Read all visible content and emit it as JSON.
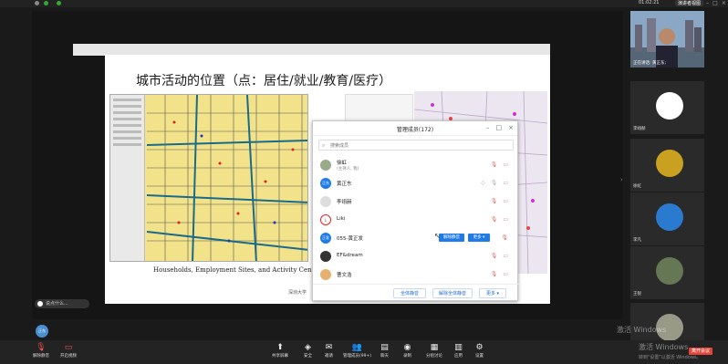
{
  "titlebar": {
    "timer": "01:02:21",
    "view_btn": "演讲者视图"
  },
  "slide": {
    "title": "城市活动的位置（点：居住/就业/教育/医疗）",
    "caption": "Households, Employment Sites, and Activity Centers",
    "university": "深圳大学"
  },
  "dialog": {
    "title": "管理成员(172)",
    "search_placeholder": "搜索成员",
    "members": [
      {
        "name": "徐虹",
        "sub": "(主持人, 我)",
        "avatar": "photo"
      },
      {
        "name": "黄正东",
        "sub": "",
        "avatar": "正东"
      },
      {
        "name": "李翊赫",
        "sub": "",
        "avatar": "photo"
      },
      {
        "name": "Liki",
        "sub": "",
        "avatar": "photo"
      },
      {
        "name": "055-黄正发",
        "sub": "",
        "avatar": "正发",
        "buttons": [
          "解除静音",
          "更多 ▾"
        ]
      },
      {
        "name": "EF&dream",
        "sub": "",
        "avatar": "photo"
      },
      {
        "name": "曹文浩",
        "sub": "",
        "avatar": "photo"
      }
    ],
    "footer": {
      "mute_all": "全体静音",
      "unmute_all": "解除全体静音",
      "more": "更多 ▾"
    }
  },
  "sidebar": {
    "speaker_label": "正在讲话: 黄正东;",
    "tiles": [
      {
        "name": "李翊赫"
      },
      {
        "name": "徐虹"
      },
      {
        "name": "李凡"
      },
      {
        "name": "王锐"
      }
    ]
  },
  "chat": {
    "text": "说点什么..."
  },
  "self_avatar": "正东",
  "toolbar": {
    "items": [
      {
        "label": "解除静音",
        "icon": "mic-muted-icon"
      },
      {
        "label": "开启视频",
        "icon": "video-off-icon"
      },
      {
        "label": "共享屏幕",
        "icon": "share-screen-icon"
      },
      {
        "label": "安全",
        "icon": "shield-icon"
      },
      {
        "label": "邀请",
        "icon": "invite-icon"
      },
      {
        "label": "管理成员(99+)",
        "icon": "members-icon"
      },
      {
        "label": "聊天",
        "icon": "chat-icon"
      },
      {
        "label": "录制",
        "icon": "record-icon"
      },
      {
        "label": "分组讨论",
        "icon": "breakout-icon"
      },
      {
        "label": "应用",
        "icon": "apps-icon"
      },
      {
        "label": "设置",
        "icon": "settings-icon"
      }
    ],
    "leave": "离开会议"
  },
  "watermark": {
    "line1": "激活 Windows",
    "line2": "转到\"设置\"以激活 Windows。"
  },
  "colors": {
    "accent": "#1f7be8",
    "leave": "#e0463a",
    "toolbar_bg": "#232323"
  }
}
